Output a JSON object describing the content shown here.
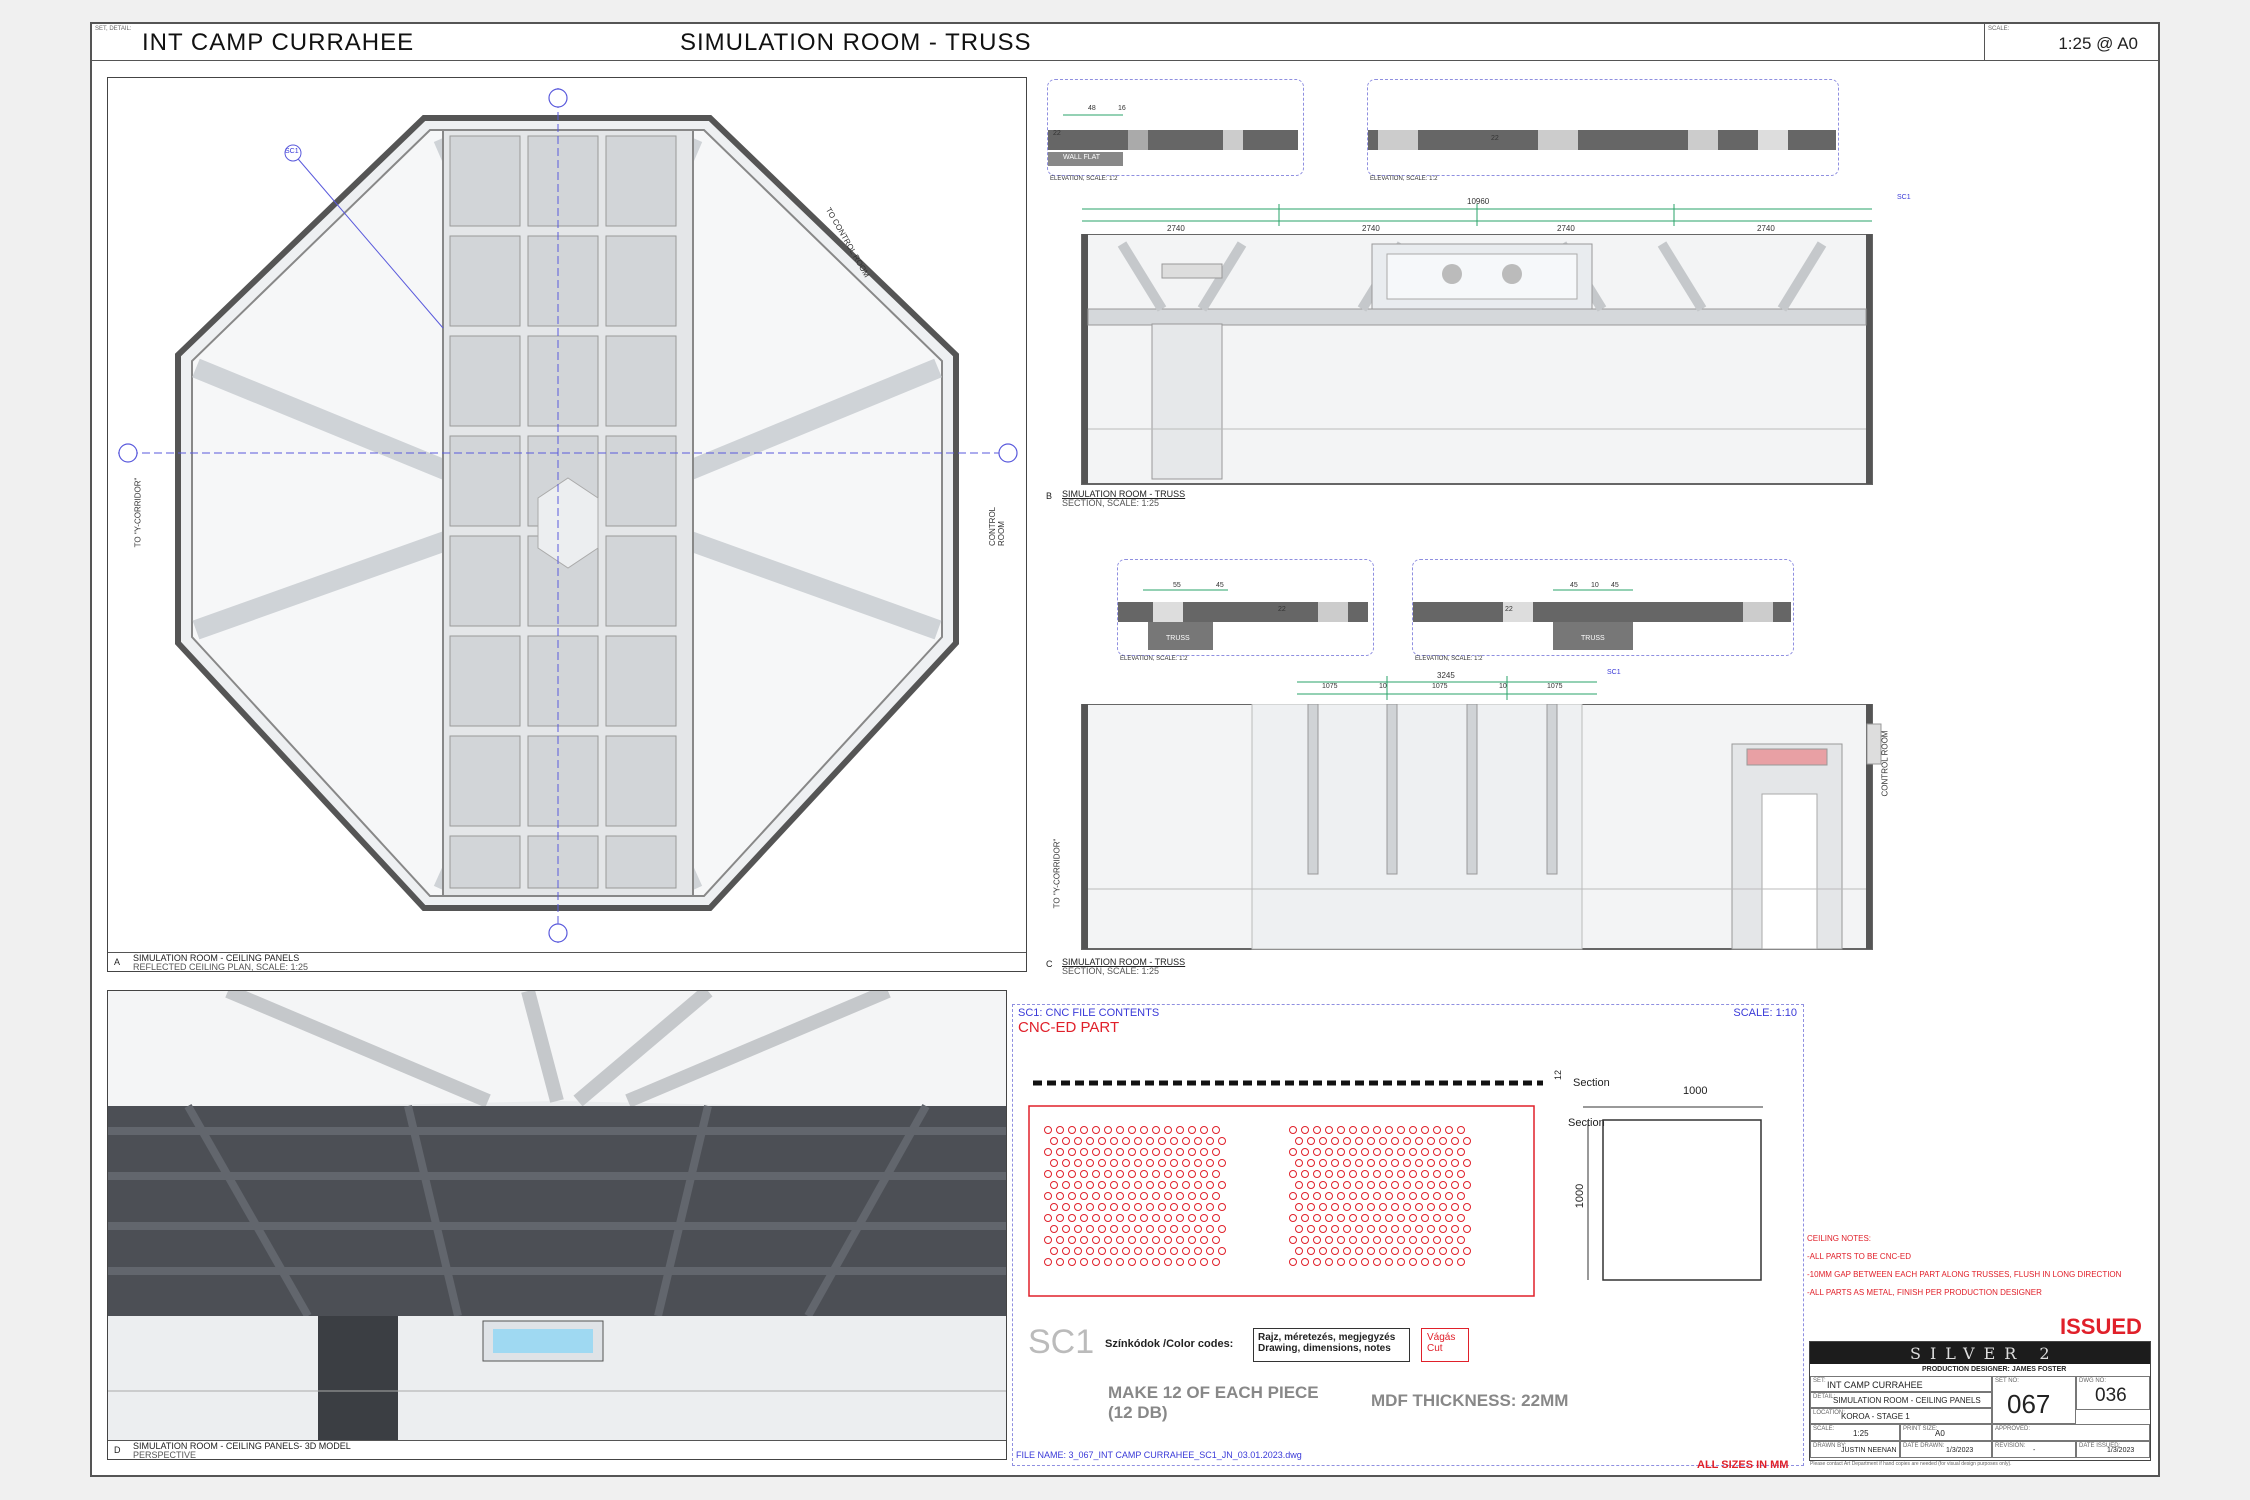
{
  "header": {
    "set_detail_label": "SET, DETAIL:",
    "set_name": "INT CAMP CURRAHEE",
    "sheet_title": "SIMULATION ROOM - TRUSS",
    "scale_label": "SCALE:",
    "scale_value": "1:25 @ A0"
  },
  "panel_a": {
    "letter": "A",
    "title": "SIMULATION ROOM - CEILING PANELS",
    "subtitle": "REFLECTED CEILING PLAN, SCALE: 1:25",
    "marker_sc1": "SC1",
    "label_control_room_diag": "TO CONTROL ROOM",
    "label_corridor": "TO \"Y-CORRIDOR\"",
    "label_control_room": "CONTROL ROOM"
  },
  "panel_b": {
    "letter": "B",
    "title": "SIMULATION ROOM - TRUSS",
    "subtitle": "SECTION, SCALE: 1:25",
    "detail1_label": "WALL FLAT",
    "detail1_dims": [
      "48",
      "16",
      "22"
    ],
    "detail1_caption": "ELEVATION, SCALE: 1:2",
    "detail2_dim": "22",
    "detail2_caption": "ELEVATION, SCALE: 1:2",
    "overall_dim": "10960",
    "segment_dims": [
      "2740",
      "2740",
      "2740",
      "2740"
    ],
    "marker_sc1": "SC1"
  },
  "panel_c": {
    "letter": "C",
    "title": "SIMULATION ROOM - TRUSS",
    "subtitle": "SECTION, SCALE: 1:25",
    "detail1_label": "TRUSS",
    "detail1_dims": [
      "55",
      "45",
      "22"
    ],
    "detail1_caption": "ELEVATION, SCALE: 1:2",
    "detail2_label": "TRUSS",
    "detail2_dims": [
      "45",
      "10",
      "45",
      "22"
    ],
    "detail2_caption": "ELEVATION, SCALE: 1:2",
    "overall_dim": "3245",
    "segment_dims": [
      "1075",
      "10",
      "1075",
      "10",
      "1075"
    ],
    "marker_sc1": "SC1",
    "label_corridor": "TO \"Y-CORRIDOR\"",
    "label_control_room": "CONTROL ROOM"
  },
  "panel_d": {
    "letter": "D",
    "title": "SIMULATION ROOM - CEILING PANELS- 3D MODEL",
    "subtitle": "PERSPECTIVE"
  },
  "cnc": {
    "header_left": "SC1: CNC FILE CONTENTS",
    "header_right": "SCALE: 1:10",
    "part_title": "CNC-ED PART",
    "section_label_1": "Section",
    "section_label_2": "Section",
    "dim_12": "12",
    "dim_width": "1000",
    "dim_height": "1000",
    "code": "SC1",
    "color_codes_label": "Színkódok /Color codes:",
    "legend_black": "Rajz, méretezés, megjegyzés\nDrawing, dimensions, notes",
    "legend_red": "Vágás\nCut",
    "make_text_1": "MAKE 12 OF EACH PIECE",
    "make_text_2": "(12 DB)",
    "thickness": "MDF THICKNESS: 22MM",
    "file_name": "FILE NAME: 3_067_INT CAMP CURRAHEE_SC1_JN_03.01.2023.dwg"
  },
  "notes": {
    "title": "CEILING NOTES:",
    "items": [
      "-ALL PARTS TO BE CNC-ED",
      "-10MM GAP BETWEEN EACH PART ALONG TRUSSES, FLUSH IN LONG DIRECTION",
      "-ALL PARTS AS METAL, FINISH PER PRODUCTION DESIGNER"
    ]
  },
  "issued": "ISSUED",
  "all_sizes": "ALL SIZES IN MM",
  "title_block": {
    "logo": "SILVER 2",
    "production_designer": "PRODUCTION DESIGNER: JAMES FOSTER",
    "set_label": "SET:",
    "set_value": "INT CAMP CURRAHEE",
    "detail_label": "DETAIL:",
    "detail_value": "SIMULATION ROOM - CEILING PANELS",
    "location_label": "LOCATION:",
    "location_value": "KOROA - STAGE 1",
    "set_no_label": "SET NO:",
    "set_no": "067",
    "dwg_no_label": "DWG NO:",
    "dwg_no": "036",
    "scale_label": "SCALE:",
    "scale_value": "1:25",
    "print_size_label": "PRINT SIZE:",
    "print_size": "A0",
    "approved_label": "APPROVED:",
    "drawn_by_label": "DRAWN BY:",
    "drawn_by": "JUSTIN NEENAN",
    "date_drawn_label": "DATE DRAWN:",
    "date_drawn": "1/3/2023",
    "revision_label": "REVISION:",
    "revision": "-",
    "date_issued_label": "DATE ISSUED:",
    "date_issued": "1/3/2023",
    "disclaimer": "Please contact Art Department if hand copies are needed (for visual design purposes only)."
  }
}
